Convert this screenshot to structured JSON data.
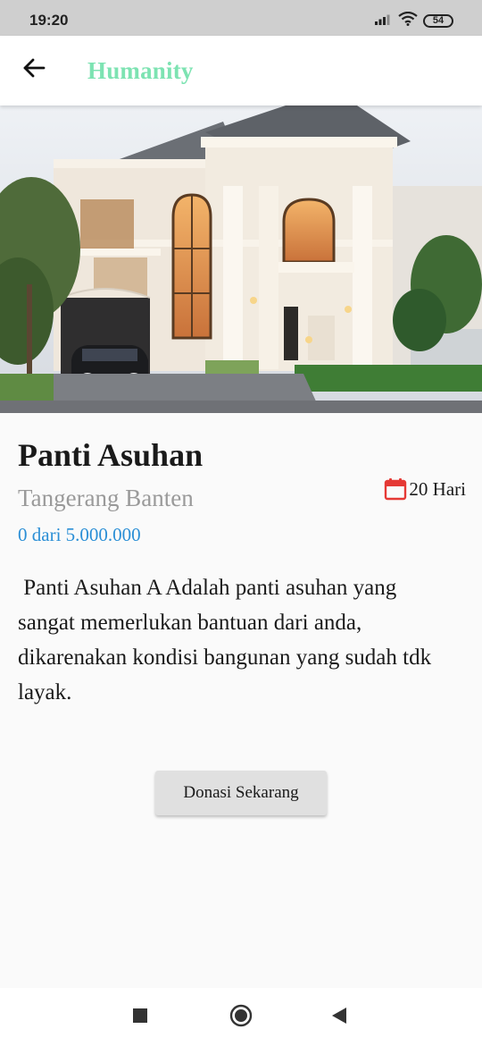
{
  "status_bar": {
    "time": "19:20",
    "battery_level": "54",
    "icons": [
      "signal-icon",
      "wifi-icon",
      "battery-icon"
    ]
  },
  "app_bar": {
    "title": "Humanity",
    "title_color": "#7de3b2",
    "back_icon": "arrow-left-icon"
  },
  "campaign": {
    "image": "house-photo",
    "title": "Panti Asuhan",
    "location": "Tangerang Banten",
    "days_icon": "calendar-icon",
    "days_icon_color": "#e53935",
    "days_left": "20 Hari",
    "progress_text": "0 dari 5.000.000",
    "progress_color": "#2b8fd6",
    "description": " Panti Asuhan A Adalah panti asuhan yang sangat memerlukan bantuan dari anda, dikarenakan kondisi bangunan yang sudah tdk layak.",
    "donate_label": "Donasi Sekarang"
  },
  "nav_bar": {
    "items": [
      "recents-square-icon",
      "home-circle-icon",
      "back-triangle-icon"
    ]
  }
}
